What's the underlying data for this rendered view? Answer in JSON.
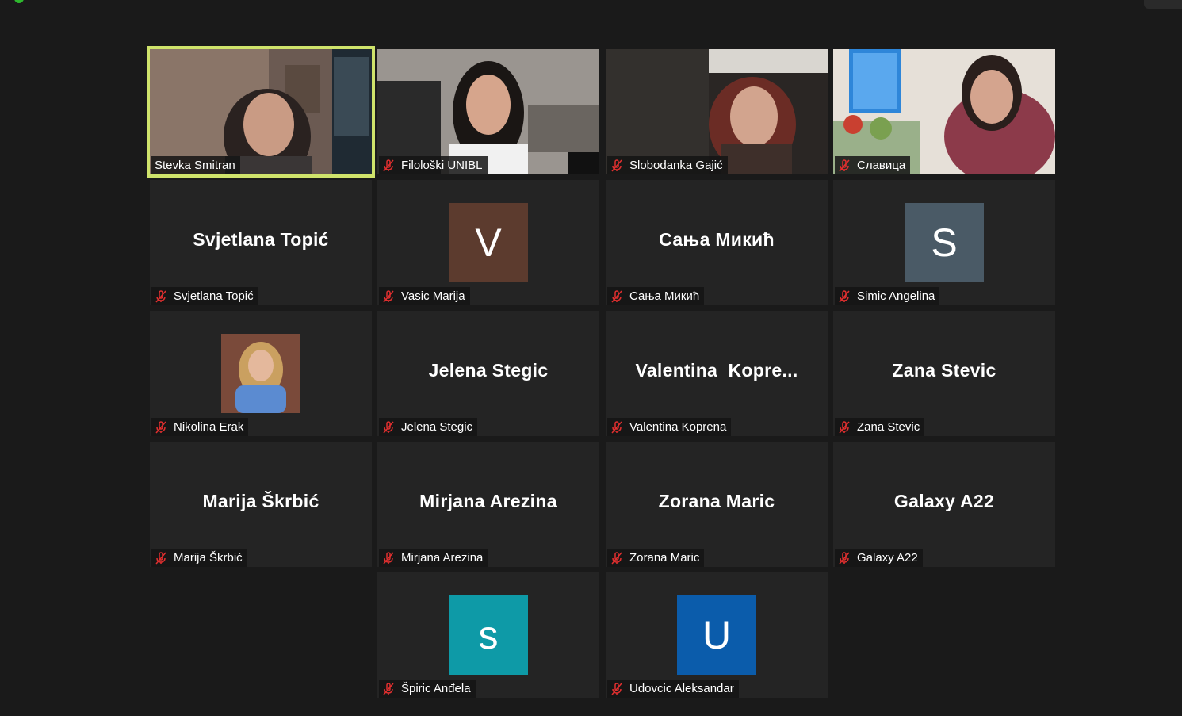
{
  "meeting": {
    "participants": [
      {
        "name": "Stevka Smitran",
        "display": "",
        "type": "video",
        "active": true,
        "muted": false
      },
      {
        "name": "Filološki UNIBL",
        "display": "",
        "type": "video",
        "muted": true
      },
      {
        "name": "Slobodanka Gajić",
        "display": "",
        "type": "video",
        "muted": true
      },
      {
        "name": "Славица",
        "display": "",
        "type": "video",
        "muted": true
      },
      {
        "name": "Svjetlana Topić",
        "display": "Svjetlana Topić",
        "type": "name",
        "muted": true
      },
      {
        "name": "Vasic Marija",
        "display": "V",
        "type": "avatar",
        "color": "#5c3b2e",
        "muted": true
      },
      {
        "name": "Сања Микић",
        "display": "Сања Микић",
        "type": "name",
        "muted": true
      },
      {
        "name": "Simic Angelina",
        "display": "S",
        "type": "avatar",
        "color": "#4a5a66",
        "muted": true
      },
      {
        "name": "Nikolina Erak",
        "display": "",
        "type": "photo",
        "muted": true
      },
      {
        "name": "Jelena Stegic",
        "display": "Jelena Stegic",
        "type": "name",
        "muted": true
      },
      {
        "name": "Valentina Koprena",
        "display": "Valentina  Kopre...",
        "type": "name",
        "muted": true
      },
      {
        "name": "Zana Stevic",
        "display": "Zana Stevic",
        "type": "name",
        "muted": true
      },
      {
        "name": "Marija Škrbić",
        "display": "Marija Škrbić",
        "type": "name",
        "muted": true
      },
      {
        "name": "Mirjana Arezina",
        "display": "Mirjana Arezina",
        "type": "name",
        "muted": true
      },
      {
        "name": "Zorana Maric",
        "display": "Zorana Maric",
        "type": "name",
        "muted": true
      },
      {
        "name": "Galaxy A22",
        "display": "Galaxy A22",
        "type": "name",
        "muted": true
      },
      {
        "name": "Špiric Anđela",
        "display": "s",
        "type": "avatar",
        "color": "#0e9aa7",
        "muted": true
      },
      {
        "name": "Udovcic Aleksandar",
        "display": "U",
        "type": "avatar",
        "color": "#0b5cab",
        "muted": true
      }
    ]
  },
  "icons": {
    "mic_muted": "mic-muted-icon"
  },
  "colors": {
    "active_border": "#cfe36b",
    "muted_red": "#e02f2f"
  }
}
